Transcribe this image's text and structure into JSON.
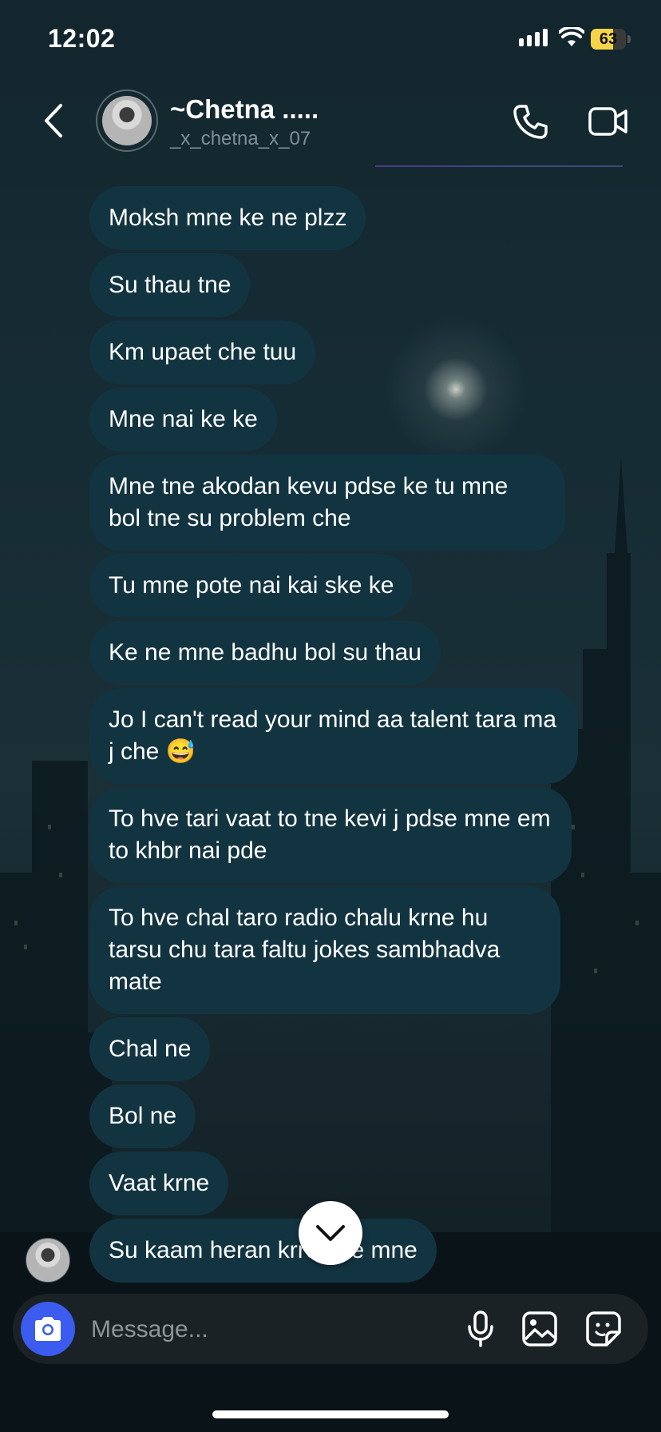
{
  "status_bar": {
    "time": "12:02",
    "battery": "63",
    "battery_level": 0.63
  },
  "header": {
    "name": "~Chetna .....",
    "handle": "_x_chetna_x_07",
    "icons": {
      "back": "chevron-left-icon",
      "call": "phone-icon",
      "video": "video-camera-icon"
    }
  },
  "messages": [
    "Moksh mne ke ne plzz",
    "Su thau tne",
    "Km upaet che tuu",
    "Mne nai ke ke",
    "Mne tne akodan kevu pdse ke tu mne bol tne su problem che",
    "Tu mne pote nai kai ske ke",
    "Ke ne mne badhu bol su thau",
    "Jo I can't read your mind aa talent tara ma j che 😅",
    "To hve tari vaat to tne kevi j pdse mne em to khbr nai pde",
    "To hve chal taro radio chalu krne hu tarsu chu tara faltu jokes sambhadva mate",
    "Chal ne",
    "Bol ne",
    "Vaat krne",
    "Su kaam heran krre che mne"
  ],
  "composer": {
    "placeholder": "Message..."
  },
  "colors": {
    "bubble": "#123441",
    "camera_button": "#3c5cf0",
    "battery": "#f5d547"
  }
}
